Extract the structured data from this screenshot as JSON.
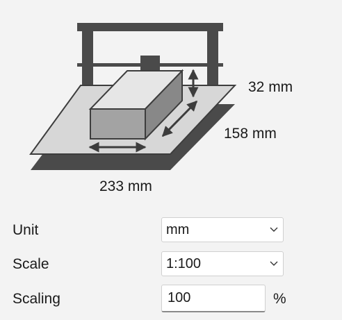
{
  "illustration": {
    "height_label": "32 mm",
    "depth_label": "158 mm",
    "width_label": "233 mm"
  },
  "form": {
    "unit": {
      "label": "Unit",
      "value": "mm"
    },
    "scale": {
      "label": "Scale",
      "value": "1:100"
    },
    "scaling": {
      "label": "Scaling",
      "value": "100",
      "suffix": "%"
    }
  },
  "colors": {
    "printer_frame": "#4a4a4a",
    "plate": "#d7d7d7",
    "model_front": "#a3a3a3",
    "model_side": "#888888",
    "model_top": "#e6e6e6"
  }
}
